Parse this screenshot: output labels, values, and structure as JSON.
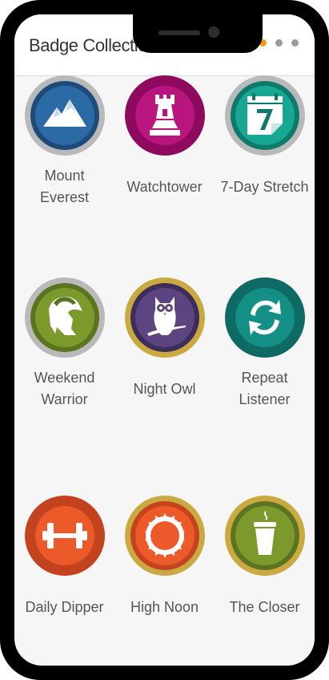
{
  "header": {
    "title": "Badge Collection"
  },
  "pager": {
    "count": 4,
    "active": 1
  },
  "badges": [
    {
      "label": "Mount\nEverest",
      "icon": "mountain-icon",
      "ring": "#b9b9b9",
      "inner": "#1f4b7a",
      "fill": "#2c6aa6"
    },
    {
      "label": "Watchtower",
      "icon": "rook-icon",
      "ring": "#8e0a5e",
      "inner": "#8e0a5e",
      "fill": "#b9157f"
    },
    {
      "label": "7-Day Stretch",
      "icon": "calendar-icon",
      "ring": "#b9b9b9",
      "inner": "#0f7a6c",
      "fill": "#18a792"
    },
    {
      "label": "Weekend\nWarrior",
      "icon": "helmet-icon",
      "ring": "#b9b9b9",
      "inner": "#5c7420",
      "fill": "#7c9a2b"
    },
    {
      "label": "Night Owl",
      "icon": "owl-icon",
      "ring": "#c9a940",
      "inner": "#3c2d5c",
      "fill": "#5b447f"
    },
    {
      "label": "Repeat\nListener",
      "icon": "repeat-icon",
      "ring": "#0e6a64",
      "inner": "#0e6a64",
      "fill": "#148f86"
    },
    {
      "label": "Daily Dipper",
      "icon": "dumbbell-icon",
      "ring": "#c4431f",
      "inner": "#c4431f",
      "fill": "#ed5a2a"
    },
    {
      "label": "High Noon",
      "icon": "sun-icon",
      "ring": "#c9a940",
      "inner": "#c4431f",
      "fill": "#ed5a2a"
    },
    {
      "label": "The Closer",
      "icon": "coffee-cup-icon",
      "ring": "#c9a940",
      "inner": "#5c7420",
      "fill": "#7c9a2b"
    }
  ]
}
